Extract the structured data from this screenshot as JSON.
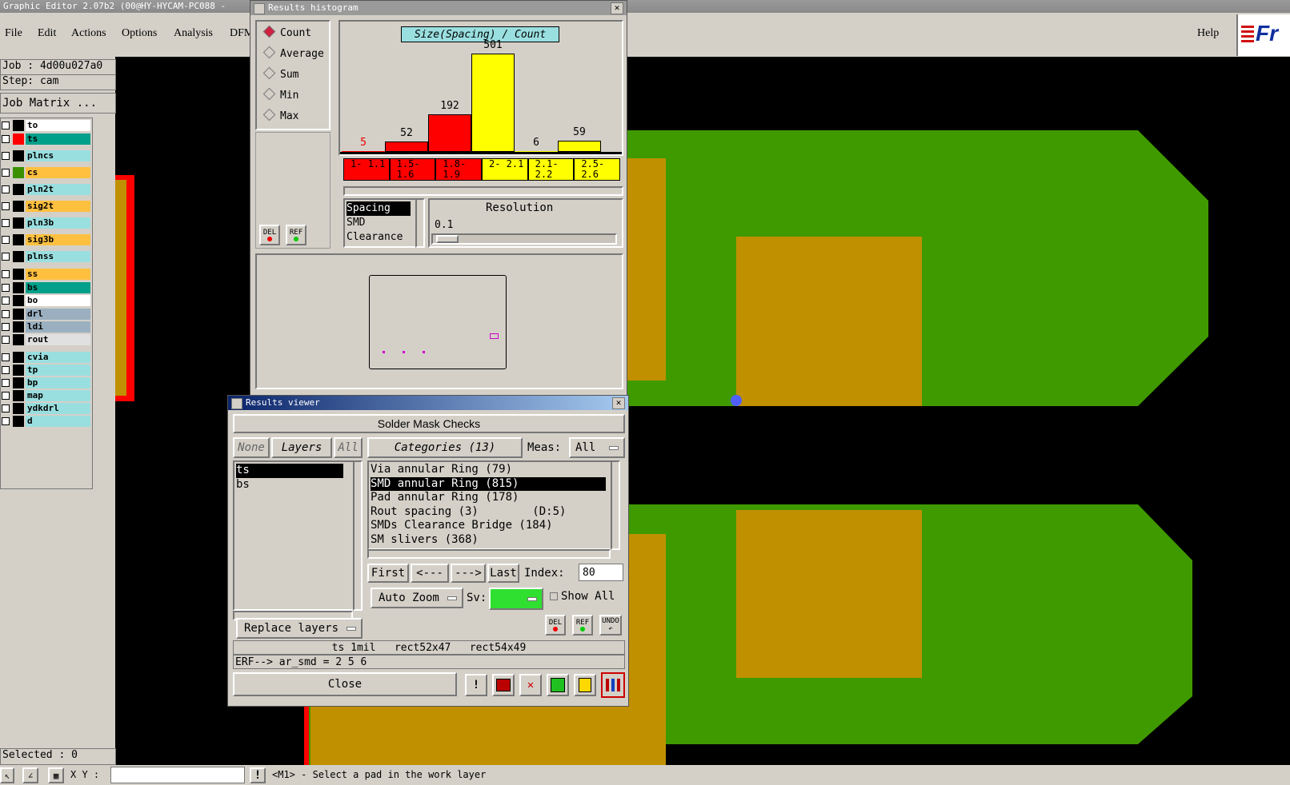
{
  "app": {
    "title": "Graphic Editor 2.07b2  (00@HY-HYCAM-PC088 -"
  },
  "menu": {
    "file": "File",
    "edit": "Edit",
    "actions": "Actions",
    "options": "Options",
    "analysis": "Analysis",
    "dfm": "DFM",
    "help": "Help",
    "brand": "Fr"
  },
  "job": {
    "job": "Job : 4d00u027a0",
    "step": "Step: cam",
    "matrix_button": "Job Matrix ...",
    "selected": "Selected : 0"
  },
  "layers": [
    {
      "name": "to",
      "color": "#ffffff",
      "swatch": "#000000"
    },
    {
      "name": "ts",
      "color": "#00a08a",
      "swatch": "#ff0000"
    },
    {
      "name": "plncs",
      "color": "#9adfe0",
      "swatch": "#000000"
    },
    {
      "name": "cs",
      "color": "#ffc040",
      "swatch": "#3a9000"
    },
    {
      "name": "pln2t",
      "color": "#9adfe0",
      "swatch": "#000000"
    },
    {
      "name": "sig2t",
      "color": "#ffc040",
      "swatch": "#000000"
    },
    {
      "name": "pln3b",
      "color": "#9adfe0",
      "swatch": "#000000"
    },
    {
      "name": "sig3b",
      "color": "#ffc040",
      "swatch": "#000000"
    },
    {
      "name": "plnss",
      "color": "#9adfe0",
      "swatch": "#000000"
    },
    {
      "name": "ss",
      "color": "#ffc040",
      "swatch": "#000000"
    },
    {
      "name": "bs",
      "color": "#00a08a",
      "swatch": "#000000"
    },
    {
      "name": "bo",
      "color": "#ffffff",
      "swatch": "#000000"
    },
    {
      "name": "drl",
      "color": "#9ab0c0",
      "swatch": "#000000"
    },
    {
      "name": "ldi",
      "color": "#9ab0c0",
      "swatch": "#000000"
    },
    {
      "name": "rout",
      "color": "#e0e0e0",
      "swatch": "#000000"
    },
    {
      "name": "cvia",
      "color": "#9adfe0",
      "swatch": "#000000"
    },
    {
      "name": "tp",
      "color": "#9adfe0",
      "swatch": "#000000"
    },
    {
      "name": "bp",
      "color": "#9adfe0",
      "swatch": "#000000"
    },
    {
      "name": "map",
      "color": "#9adfe0",
      "swatch": "#000000"
    },
    {
      "name": "ydkdrl",
      "color": "#9adfe0",
      "swatch": "#000000"
    },
    {
      "name": "d",
      "color": "#9adfe0",
      "swatch": "#000000"
    }
  ],
  "histogram": {
    "title": "Results histogram",
    "modes": [
      "Count",
      "Average",
      "Sum",
      "Min",
      "Max"
    ],
    "selected_mode": "Count",
    "chart_title": "Size(Spacing) / Count",
    "del": "DEL",
    "ref": "REF",
    "types": [
      "Spacing",
      "SMD",
      "Clearance"
    ],
    "selected_type": "Spacing",
    "resolution_label": "Resolution",
    "resolution_value": "0.1"
  },
  "chart_data": {
    "type": "bar",
    "title": "Size(Spacing) / Count",
    "categories": [
      "1- 1.1",
      "1.5- 1.6",
      "1.8- 1.9",
      "2- 2.1",
      "2.1- 2.2",
      "2.5- 2.6"
    ],
    "values": [
      5,
      52,
      192,
      501,
      6,
      59
    ],
    "colors": [
      "#ff0000",
      "#ff0000",
      "#ff0000",
      "#ffff00",
      "#ffff00",
      "#ffff00"
    ]
  },
  "viewer": {
    "title": "Results viewer",
    "header": "Solder Mask Checks",
    "none": "None",
    "layers": "Layers",
    "all": "All",
    "categories": "Categories (13)",
    "meas_label": "Meas:",
    "meas_value": "All",
    "layer_list": [
      "ts",
      "bs"
    ],
    "category_list": [
      "Via annular Ring (79)",
      "SMD annular Ring (815)",
      "Pad annular Ring (178)",
      "Rout spacing (3)        (D:5)",
      "SMDs Clearance Bridge (184)",
      "SM slivers (368)"
    ],
    "first": "First",
    "prev": "<---",
    "next": "--->",
    "last": "Last",
    "index_label": "Index:",
    "index_value": "80",
    "auto_zoom": "Auto Zoom",
    "sv_label": "Sv:",
    "show_all": "Show All",
    "replace_layers": "Replace layers",
    "del": "DEL",
    "ref": "REF",
    "undo": "UNDO",
    "info_line": "ts 1mil   rect52x47   rect54x49",
    "erf_line": "ERF--> ar_smd = 2 5 6",
    "close": "Close"
  },
  "status": {
    "xy_label": "X Y :",
    "message": "<M1> - Select a pad in the work layer"
  }
}
